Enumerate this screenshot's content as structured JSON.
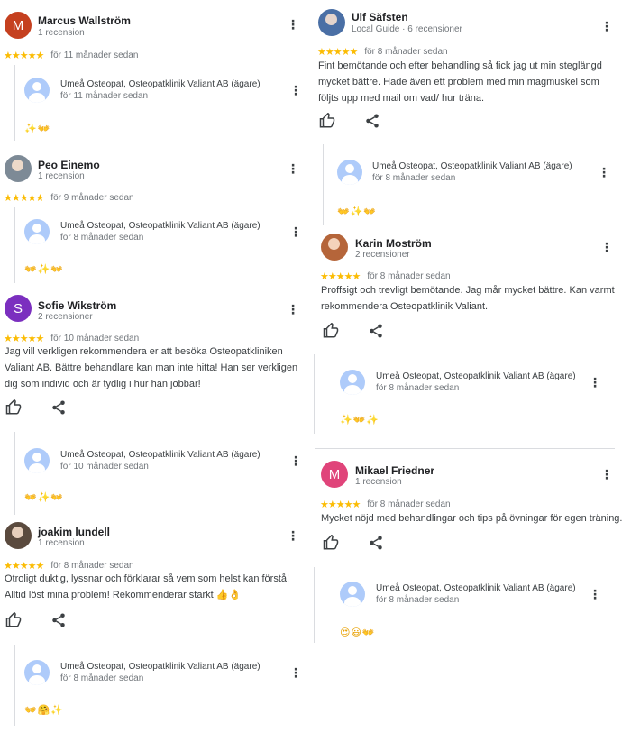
{
  "owner_reply_name": "Umeå Osteopat, Osteopatklinik Valiant AB (ägare)",
  "colors": {
    "star": "#fbbc04",
    "text": "#202124",
    "muted": "#70757a"
  },
  "left_column": [
    {
      "name": "Marcus Wallström",
      "meta": "1 recension",
      "avatar_letter": "M",
      "avatar_color": "#c5401f",
      "ago": "för 11 månader sedan",
      "text": "",
      "reply": {
        "date": "för 11 månader sedan",
        "emoji": "✨👐"
      }
    },
    {
      "name": "Peo Einemo",
      "meta": "1 recension",
      "avatar_letter": "",
      "avatar_color": "#7d8a96",
      "ago": "för 9 månader sedan",
      "text": "",
      "reply": {
        "date": "för 8 månader sedan",
        "emoji": "👐✨👐"
      }
    },
    {
      "name": "Sofie Wikström",
      "meta": "2 recensioner",
      "avatar_letter": "S",
      "avatar_color": "#7b2fbf",
      "ago": "för 10 månader sedan",
      "text": "Jag vill verkligen rekommendera er att besöka Osteopatkliniken Valiant AB. Bättre behandlare kan man inte hitta! Han ser verkligen dig som individ och är tydlig i hur han jobbar!",
      "reply": {
        "date": "för 10 månader sedan",
        "emoji": "👐✨👐"
      }
    },
    {
      "name": "joakim lundell",
      "meta": "1 recension",
      "avatar_letter": "",
      "avatar_color": "#5a4a3e",
      "ago": "för 8 månader sedan",
      "text": "Otroligt duktig, lyssnar och förklarar så vem som helst kan förstå! Alltid löst mina problem! Rekommenderar starkt 👍👌",
      "reply": {
        "date": "för 8 månader sedan",
        "emoji": "👐🤗✨"
      }
    }
  ],
  "right_column": [
    {
      "name": "Ulf Säfsten",
      "meta": "Local Guide · 6 recensioner",
      "avatar_letter": "",
      "avatar_color": "#4a6fa5",
      "ago": "för 8 månader sedan",
      "text": "Fint bemötande och efter behandling så fick jag ut min steglängd mycket bättre. Hade även ett problem med min magmuskel som följts upp med mail om vad/ hur träna.",
      "reply": {
        "date": "för 8 månader sedan",
        "emoji": "👐✨👐"
      }
    },
    {
      "name": "Karin Moström",
      "meta": "2 recensioner",
      "avatar_letter": "",
      "avatar_color": "#b5653a",
      "ago": "för 8 månader sedan",
      "text": "Proffsigt och trevligt bemötande. Jag mår mycket bättre. Kan varmt rekommendera Osteopatklinik Valiant.",
      "reply": {
        "date": "för 8 månader sedan",
        "emoji": "✨👐✨"
      }
    },
    {
      "name": "Mikael Friedner",
      "meta": "1 recension",
      "avatar_letter": "M",
      "avatar_color": "#e0447a",
      "ago": "för 8 månader sedan",
      "text": "Mycket nöjd med behandlingar och tips på övningar för egen träning.",
      "reply": {
        "date": "för 8 månader sedan",
        "emoji": "😍😃👐"
      }
    }
  ]
}
